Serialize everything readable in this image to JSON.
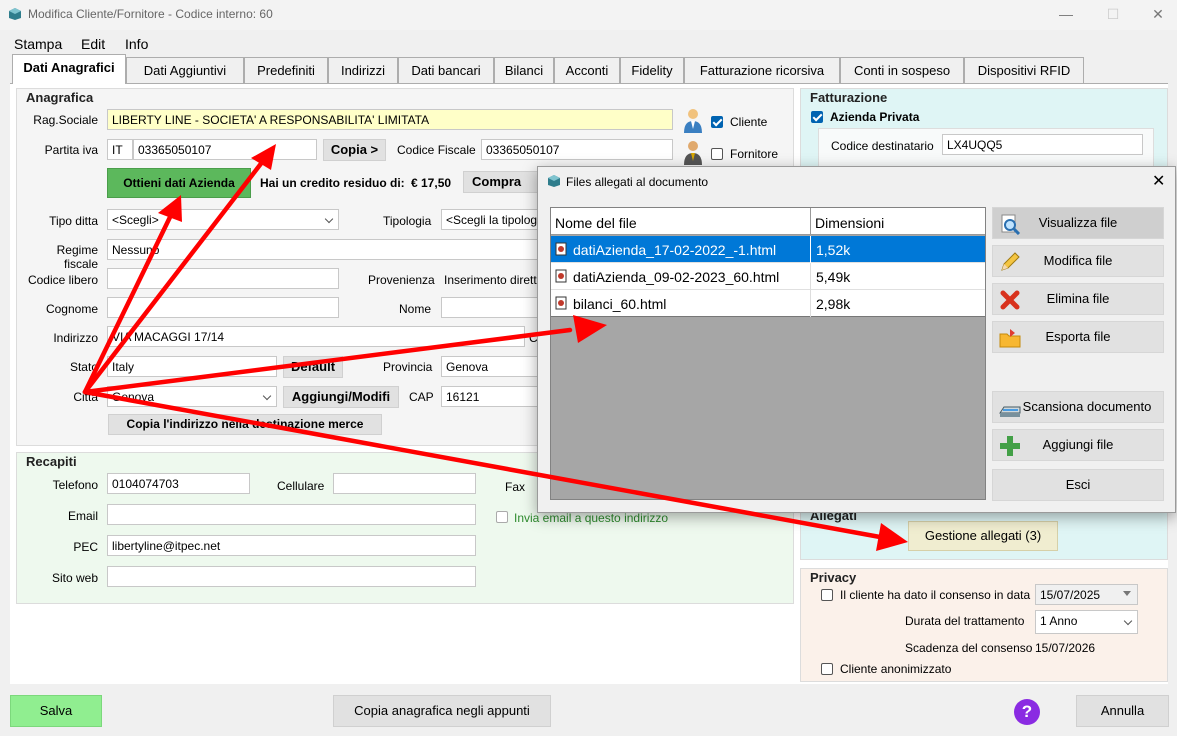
{
  "window": {
    "title": "Modifica Cliente/Fornitore - Codice interno: 60"
  },
  "menu": [
    "Stampa",
    "Edit",
    "Info"
  ],
  "tabs": [
    "Dati Anagrafici",
    "Dati Aggiuntivi",
    "Predefiniti",
    "Indirizzi",
    "Dati bancari",
    "Bilanci",
    "Acconti",
    "Fidelity",
    "Fatturazione ricorsiva",
    "Conti in sospeso",
    "Dispositivi RFID"
  ],
  "anagrafica": {
    "title": "Anagrafica",
    "rag_sociale_label": "Rag.Sociale",
    "rag_sociale": "LIBERTY LINE - SOCIETA' A RESPONSABILITA' LIMITATA",
    "cliente_label": "Cliente",
    "fornitore_label": "Fornitore",
    "piva_label": "Partita iva",
    "piva_country": "IT",
    "piva": "03365050107",
    "copia_label": "Copia >",
    "cf_label": "Codice Fiscale",
    "cf": "03365050107",
    "ottieni_label": "Ottieni dati Azienda",
    "credito_label": "Hai un credito residuo di:",
    "credito_value": "€ 17,50",
    "compra_label": "Compra cre",
    "tipo_ditta_label": "Tipo ditta",
    "tipo_ditta": "<Scegli>",
    "tipologia_label": "Tipologia",
    "tipologia": "<Scegli la tipolog",
    "regime_label": "Regime fiscale",
    "regime": "Nessuno",
    "codice_libero_label": "Codice libero",
    "provenienza_label": "Provenienza",
    "provenienza": "Inserimento dirett",
    "cognome_label": "Cognome",
    "nome_label": "Nome",
    "indirizzo_label": "Indirizzo",
    "indirizzo": "VIA MACAGGI 17/14",
    "indirizzo_extra": "C",
    "stato_label": "Stato",
    "stato": "Italy",
    "default_label": "Default",
    "provincia_label": "Provincia",
    "provincia": "Genova",
    "citta_label": "Città",
    "citta": "Genova",
    "aggiungi_label": "Aggiungi/Modifi",
    "cap_label": "CAP",
    "cap": "16121",
    "copia_indirizzo_label": "Copia l'indirizzo nella destinazione merce"
  },
  "recapiti": {
    "title": "Recapiti",
    "telefono_label": "Telefono",
    "telefono": "0104074703",
    "cellulare_label": "Cellulare",
    "fax_label": "Fax",
    "email_label": "Email",
    "invia_email_label": "Invia email a questo indirizzo",
    "pec_label": "PEC",
    "pec": "libertyline@itpec.net",
    "sito_label": "Sito web"
  },
  "fatturazione": {
    "title": "Fatturazione",
    "azienda_privata_label": "Azienda Privata",
    "codice_dest_label": "Codice destinatario",
    "codice_dest": "LX4UQQ5"
  },
  "allegati": {
    "title": "Allegati",
    "gestione_label": "Gestione allegati (3)"
  },
  "privacy": {
    "title": "Privacy",
    "consenso_label": "Il cliente ha dato il consenso in data",
    "consenso_date": "15/07/2025",
    "durata_label": "Durata del trattamento",
    "durata": "1 Anno",
    "scadenza_label": "Scadenza del consenso",
    "scadenza": "15/07/2026",
    "anonimizzato_label": "Cliente anonimizzato"
  },
  "footer": {
    "salva": "Salva",
    "copia_anagrafica": "Copia anagrafica negli appunti",
    "help": "?",
    "annulla": "Annulla"
  },
  "dialog": {
    "title": "Files allegati al documento",
    "close": "✕",
    "col_name": "Nome del file",
    "col_size": "Dimensioni",
    "files": [
      {
        "name": "datiAzienda_17-02-2022_-1.html",
        "size": "1,52k"
      },
      {
        "name": "datiAzienda_09-02-2023_60.html",
        "size": "5,49k"
      },
      {
        "name": "bilanci_60.html",
        "size": "2,98k"
      }
    ],
    "buttons": [
      "Visualizza file",
      "Modifica file",
      "Elimina file",
      "Esporta file",
      "Scansiona documento",
      "Aggiungi file",
      "Esci"
    ]
  },
  "colors": {
    "accent": "#0078d7",
    "green_button": "#5cb85c",
    "salva": "#90ee90",
    "annotation": "#ff0000"
  }
}
